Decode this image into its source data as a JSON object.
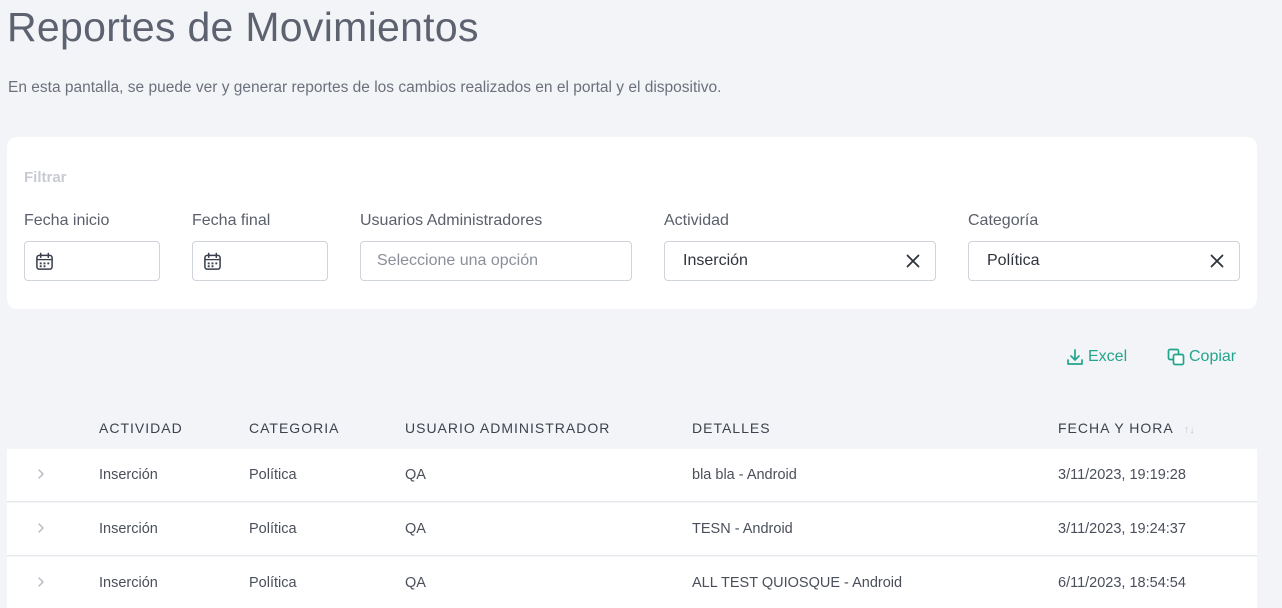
{
  "page": {
    "title": "Reportes de Movimientos",
    "subtitle": "En esta pantalla, se puede ver y generar reportes de los cambios realizados en el portal y el dispositivo."
  },
  "filter": {
    "title": "Filtrar",
    "fields": {
      "fecha_inicio": {
        "label": "Fecha inicio",
        "value": ""
      },
      "fecha_final": {
        "label": "Fecha final",
        "value": ""
      },
      "usuarios": {
        "label": "Usuarios Administradores",
        "placeholder": "Seleccione una opción"
      },
      "actividad": {
        "label": "Actividad",
        "value": "Inserción"
      },
      "categoria": {
        "label": "Categoría",
        "value": "Política"
      }
    }
  },
  "actions": {
    "excel_label": "Excel",
    "copy_label": "Copiar"
  },
  "table": {
    "headers": {
      "actividad": "Actividad",
      "categoria": "Categoria",
      "usuario": "Usuario Administrador",
      "detalles": "Detalles",
      "fecha": "Fecha y hora"
    },
    "rows": [
      {
        "actividad": "Inserción",
        "categoria": "Política",
        "usuario": "QA",
        "detalles": "bla bla - Android",
        "fecha": "3/11/2023, 19:19:28"
      },
      {
        "actividad": "Inserción",
        "categoria": "Política",
        "usuario": "QA",
        "detalles": "TESN - Android",
        "fecha": "3/11/2023, 19:24:37"
      },
      {
        "actividad": "Inserción",
        "categoria": "Política",
        "usuario": "QA",
        "detalles": "ALL TEST QUIOSQUE - Android",
        "fecha": "6/11/2023, 18:54:54"
      }
    ]
  },
  "colors": {
    "accent": "#22a58d",
    "background": "#f3f4f7",
    "card": "#ffffff"
  }
}
